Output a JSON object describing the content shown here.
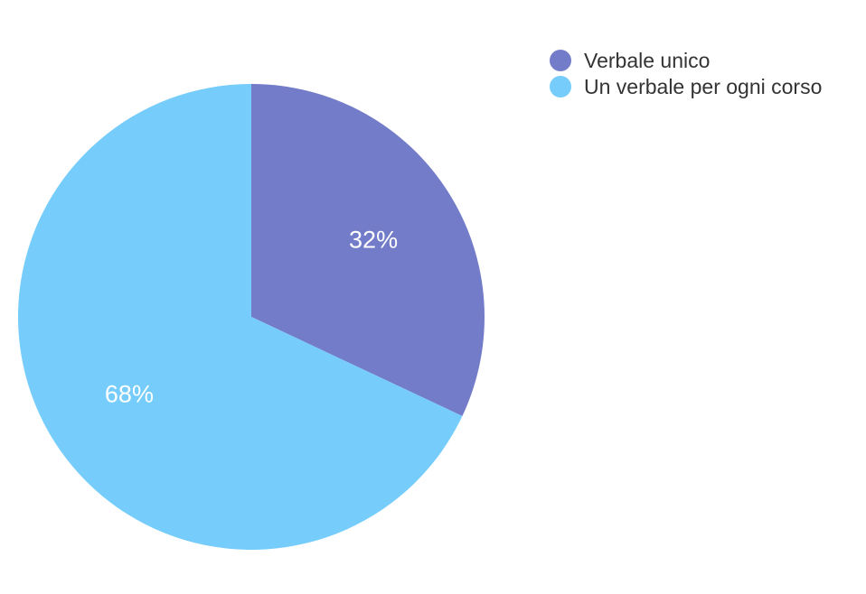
{
  "chart_data": {
    "type": "pie",
    "categories": [
      "Verbale unico",
      "Un verbale per ogni corso"
    ],
    "values": [
      32,
      68
    ],
    "value_labels": [
      "32%",
      "68%"
    ],
    "colors": [
      "#737cc8",
      "#76cdfb"
    ],
    "start": "12 o'clock, clockwise",
    "legend_position": "top-right"
  }
}
